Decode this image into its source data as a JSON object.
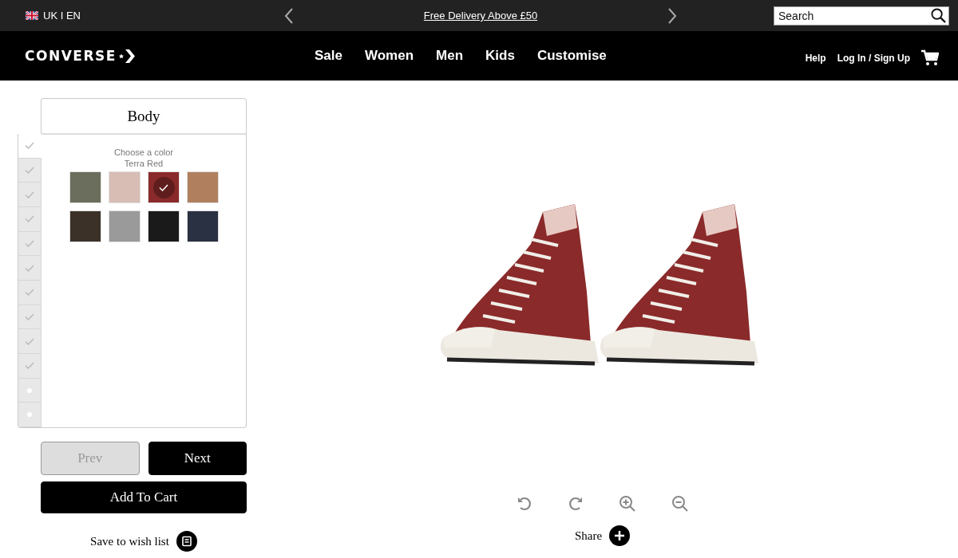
{
  "top_bar": {
    "locale": "UK I EN",
    "promo": "Free Delivery Above £50",
    "search": {
      "placeholder": "Search"
    }
  },
  "nav": {
    "logo": "CONVERSE",
    "links": [
      "Sale",
      "Women",
      "Men",
      "Kids",
      "Customise"
    ],
    "account_links": [
      "Help",
      "Log In / Sign Up"
    ]
  },
  "customizer": {
    "section_title": "Body",
    "steps": [
      {
        "kind": "done",
        "selected": true
      },
      {
        "kind": "done",
        "selected": false
      },
      {
        "kind": "done",
        "selected": false
      },
      {
        "kind": "done",
        "selected": false
      },
      {
        "kind": "done",
        "selected": false
      },
      {
        "kind": "done",
        "selected": false
      },
      {
        "kind": "done",
        "selected": false
      },
      {
        "kind": "done",
        "selected": false
      },
      {
        "kind": "done",
        "selected": false
      },
      {
        "kind": "done",
        "selected": false
      },
      {
        "kind": "todo",
        "selected": false
      },
      {
        "kind": "todo",
        "selected": false
      }
    ],
    "prompt": "Choose a color",
    "selected_color_name": "Terra Red",
    "swatches": [
      {
        "color": "#6b6e5c",
        "selected": false
      },
      {
        "color": "#d8bdb4",
        "selected": false
      },
      {
        "color": "#8a2a2a",
        "selected": true
      },
      {
        "color": "#b0805e",
        "selected": false
      },
      {
        "color": "#3b3128",
        "selected": false
      },
      {
        "color": "#9a9a9a",
        "selected": false
      },
      {
        "color": "#1a1a1a",
        "selected": false
      },
      {
        "color": "#2a3142",
        "selected": false
      }
    ],
    "buttons": [
      {
        "label": "Prev",
        "disabled": true
      },
      {
        "label": "Next",
        "disabled": false
      }
    ],
    "add_to_cart": "Add To Cart",
    "wish_list": "Save to wish list"
  },
  "viewer": {
    "share": "Share"
  }
}
